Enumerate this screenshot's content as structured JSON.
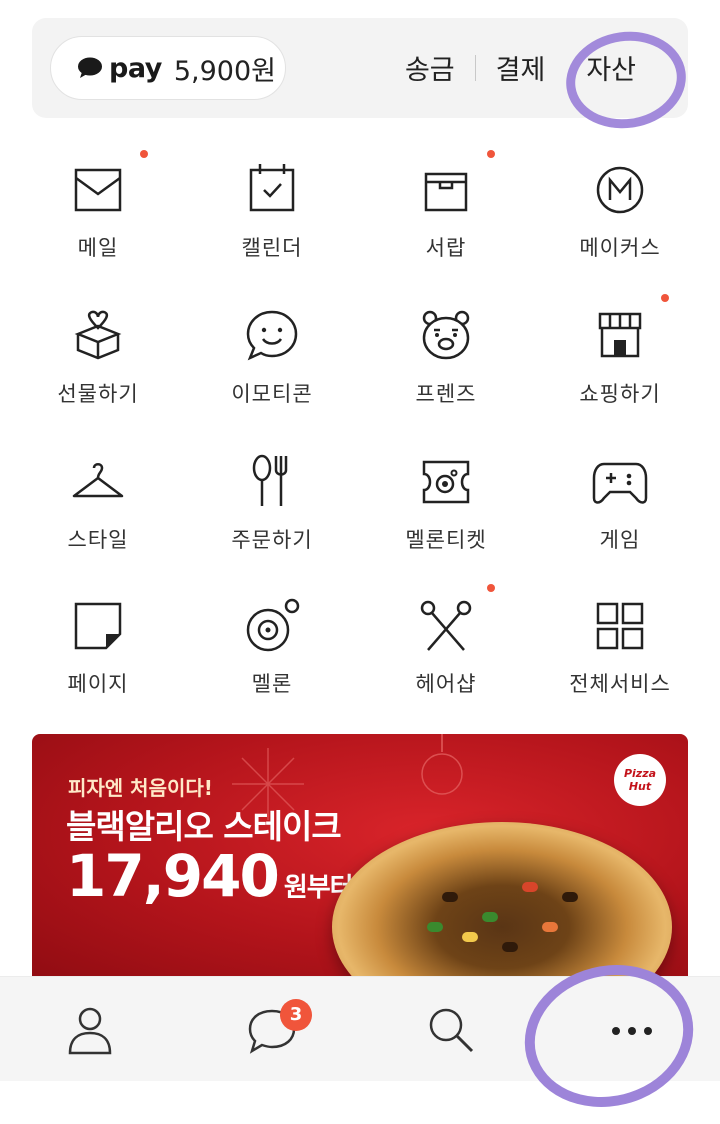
{
  "pay": {
    "logo": "pay",
    "amount": "5,900원",
    "links": [
      "송금",
      "결제",
      "자산"
    ]
  },
  "services": [
    {
      "label": "메일",
      "icon": "mail-icon",
      "new": true
    },
    {
      "label": "캘린더",
      "icon": "calendar-icon",
      "new": false
    },
    {
      "label": "서랍",
      "icon": "drawer-icon",
      "new": true
    },
    {
      "label": "메이커스",
      "icon": "makers-icon",
      "new": false
    },
    {
      "label": "선물하기",
      "icon": "gift-icon",
      "new": false
    },
    {
      "label": "이모티콘",
      "icon": "emoticon-icon",
      "new": false
    },
    {
      "label": "프렌즈",
      "icon": "friends-icon",
      "new": false
    },
    {
      "label": "쇼핑하기",
      "icon": "shopping-icon",
      "new": true
    },
    {
      "label": "스타일",
      "icon": "hanger-icon",
      "new": false
    },
    {
      "label": "주문하기",
      "icon": "utensils-icon",
      "new": false
    },
    {
      "label": "멜론티켓",
      "icon": "ticket-icon",
      "new": false
    },
    {
      "label": "게임",
      "icon": "gamepad-icon",
      "new": false
    },
    {
      "label": "페이지",
      "icon": "page-icon",
      "new": false
    },
    {
      "label": "멜론",
      "icon": "melon-icon",
      "new": false
    },
    {
      "label": "헤어샵",
      "icon": "scissors-icon",
      "new": true
    },
    {
      "label": "전체서비스",
      "icon": "all-services-icon",
      "new": false
    }
  ],
  "banner": {
    "small": "피자엔 처음이다!",
    "title": "블랙알리오 스테이크",
    "price": "17,940",
    "price_unit": "원부터",
    "logo": "Pizza Hut"
  },
  "bottom_nav": {
    "chat_badge": "3",
    "items": [
      "profile-icon",
      "chat-icon",
      "search-icon",
      "more-icon"
    ]
  },
  "colors": {
    "accent_dot": "#f0553b",
    "annotation": "#9d84d9",
    "banner_red": "#c3121a"
  }
}
